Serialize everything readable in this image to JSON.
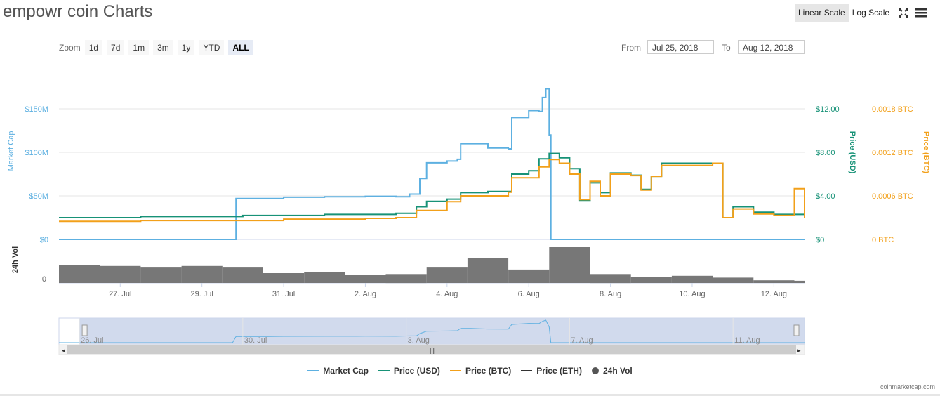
{
  "title": "empowr coin Charts",
  "scale_buttons": {
    "linear": "Linear Scale",
    "log": "Log Scale"
  },
  "icons": {
    "fullscreen": "fullscreen-icon",
    "menu": "hamburger-menu-icon"
  },
  "zoom": {
    "label": "Zoom",
    "buttons": [
      "1d",
      "7d",
      "1m",
      "3m",
      "1y",
      "YTD",
      "ALL"
    ],
    "active": "ALL"
  },
  "range": {
    "from_label": "From",
    "from_value": "Jul 25, 2018",
    "to_label": "To",
    "to_value": "Aug 12, 2018"
  },
  "colors": {
    "market_cap": "#5db0e1",
    "price_usd": "#179277",
    "price_btc": "#f2a01a",
    "price_eth": "#333333",
    "volume": "#777777",
    "navigator_fill": "#ccd6eb"
  },
  "chart_data": {
    "type": "line",
    "x_range": [
      "2018-07-25T12:00",
      "2018-08-12T18:00"
    ],
    "x_ticks": [
      {
        "date": "2018-07-27",
        "label": "27. Jul"
      },
      {
        "date": "2018-07-29",
        "label": "29. Jul"
      },
      {
        "date": "2018-07-31",
        "label": "31. Jul"
      },
      {
        "date": "2018-08-02",
        "label": "2. Aug"
      },
      {
        "date": "2018-08-04",
        "label": "4. Aug"
      },
      {
        "date": "2018-08-06",
        "label": "6. Aug"
      },
      {
        "date": "2018-08-08",
        "label": "8. Aug"
      },
      {
        "date": "2018-08-10",
        "label": "10. Aug"
      },
      {
        "date": "2018-08-12",
        "label": "12. Aug"
      }
    ],
    "axes": {
      "market_cap": {
        "title": "Market Cap",
        "range": [
          0,
          150000000
        ],
        "ticks": [
          {
            "value": 0,
            "label": "$0"
          },
          {
            "value": 50000000,
            "label": "$50M"
          },
          {
            "value": 100000000,
            "label": "$100M"
          },
          {
            "value": 150000000,
            "label": "$150M"
          }
        ]
      },
      "price_usd": {
        "title": "Price (USD)",
        "range": [
          0,
          12
        ],
        "ticks": [
          {
            "value": 0,
            "label": "$0"
          },
          {
            "value": 4,
            "label": "$4.00"
          },
          {
            "value": 8,
            "label": "$8.00"
          },
          {
            "value": 12,
            "label": "$12.00"
          }
        ]
      },
      "price_btc": {
        "title": "Price (BTC)",
        "range": [
          0,
          0.0018
        ],
        "ticks": [
          {
            "value": 0,
            "label": "0 BTC"
          },
          {
            "value": 0.0006,
            "label": "0.0006 BTC"
          },
          {
            "value": 0.0012,
            "label": "0.0012 BTC"
          },
          {
            "value": 0.0018,
            "label": "0.0018 BTC"
          }
        ]
      },
      "volume": {
        "title": "24h Vol",
        "ticks": [
          {
            "value": 0,
            "label": "0"
          }
        ]
      }
    },
    "series": [
      {
        "name": "Market Cap",
        "axis": "market_cap",
        "points": [
          [
            "2018-07-25T12:00",
            0
          ],
          [
            "2018-07-29T18:00",
            0
          ],
          [
            "2018-07-29T20:00",
            47000000
          ],
          [
            "2018-07-30T12:00",
            47000000
          ],
          [
            "2018-07-31T00:00",
            48500000
          ],
          [
            "2018-08-01T00:00",
            49000000
          ],
          [
            "2018-08-02T00:00",
            49500000
          ],
          [
            "2018-08-02T18:00",
            49000000
          ],
          [
            "2018-08-03T02:00",
            52000000
          ],
          [
            "2018-08-03T06:00",
            52000000
          ],
          [
            "2018-08-03T08:00",
            70000000
          ],
          [
            "2018-08-03T12:00",
            88000000
          ],
          [
            "2018-08-04T00:00",
            90000000
          ],
          [
            "2018-08-04T06:00",
            92000000
          ],
          [
            "2018-08-04T08:00",
            110000000
          ],
          [
            "2018-08-04T14:00",
            110000000
          ],
          [
            "2018-08-05T00:00",
            105000000
          ],
          [
            "2018-08-05T12:00",
            104000000
          ],
          [
            "2018-08-05T14:00",
            140000000
          ],
          [
            "2018-08-06T00:00",
            148000000
          ],
          [
            "2018-08-06T06:00",
            147000000
          ],
          [
            "2018-08-06T08:00",
            163000000
          ],
          [
            "2018-08-06T10:00",
            173000000
          ],
          [
            "2018-08-06T12:00",
            120000000
          ],
          [
            "2018-08-06T13:00",
            0
          ],
          [
            "2018-08-12T18:00",
            0
          ]
        ]
      },
      {
        "name": "Price (USD)",
        "axis": "price_usd",
        "points": [
          [
            "2018-07-25T12:00",
            2.0
          ],
          [
            "2018-07-26T12:00",
            2.0
          ],
          [
            "2018-07-27T12:00",
            2.1
          ],
          [
            "2018-07-29T00:00",
            2.1
          ],
          [
            "2018-07-30T00:00",
            2.2
          ],
          [
            "2018-07-31T00:00",
            2.2
          ],
          [
            "2018-08-01T00:00",
            2.3
          ],
          [
            "2018-08-02T00:00",
            2.3
          ],
          [
            "2018-08-02T18:00",
            2.4
          ],
          [
            "2018-08-03T06:00",
            3.0
          ],
          [
            "2018-08-03T12:00",
            3.5
          ],
          [
            "2018-08-04T00:00",
            3.7
          ],
          [
            "2018-08-04T08:00",
            4.3
          ],
          [
            "2018-08-05T00:00",
            4.4
          ],
          [
            "2018-08-05T12:00",
            4.4
          ],
          [
            "2018-08-05T14:00",
            6.0
          ],
          [
            "2018-08-06T00:00",
            6.3
          ],
          [
            "2018-08-06T06:00",
            7.4
          ],
          [
            "2018-08-06T12:00",
            7.9
          ],
          [
            "2018-08-06T18:00",
            7.5
          ],
          [
            "2018-08-07T00:00",
            6.5
          ],
          [
            "2018-08-07T06:00",
            3.6
          ],
          [
            "2018-08-07T12:00",
            5.2
          ],
          [
            "2018-08-07T18:00",
            4.3
          ],
          [
            "2018-08-08T00:00",
            6.1
          ],
          [
            "2018-08-08T12:00",
            5.9
          ],
          [
            "2018-08-08T18:00",
            4.6
          ],
          [
            "2018-08-09T00:00",
            5.8
          ],
          [
            "2018-08-09T06:00",
            7.0
          ],
          [
            "2018-08-09T18:00",
            7.0
          ],
          [
            "2018-08-10T00:00",
            7.0
          ],
          [
            "2018-08-10T12:00",
            7.0
          ],
          [
            "2018-08-10T18:00",
            2.0
          ],
          [
            "2018-08-11T00:00",
            3.0
          ],
          [
            "2018-08-11T12:00",
            2.5
          ],
          [
            "2018-08-12T00:00",
            2.3
          ],
          [
            "2018-08-12T18:00",
            2.0
          ]
        ]
      },
      {
        "name": "Price (BTC)",
        "axis": "price_btc",
        "points": [
          [
            "2018-07-25T12:00",
            0.00025
          ],
          [
            "2018-07-27T12:00",
            0.00026
          ],
          [
            "2018-07-29T00:00",
            0.00026
          ],
          [
            "2018-07-31T00:00",
            0.00028
          ],
          [
            "2018-08-02T00:00",
            0.00029
          ],
          [
            "2018-08-02T18:00",
            0.0003
          ],
          [
            "2018-08-03T06:00",
            0.0004
          ],
          [
            "2018-08-04T00:00",
            0.00052
          ],
          [
            "2018-08-04T08:00",
            0.0006
          ],
          [
            "2018-08-05T12:00",
            0.00065
          ],
          [
            "2018-08-05T14:00",
            0.00085
          ],
          [
            "2018-08-06T06:00",
            0.001
          ],
          [
            "2018-08-06T12:00",
            0.0011
          ],
          [
            "2018-08-06T18:00",
            0.00105
          ],
          [
            "2018-08-07T00:00",
            0.0009
          ],
          [
            "2018-08-07T06:00",
            0.00055
          ],
          [
            "2018-08-07T12:00",
            0.0008
          ],
          [
            "2018-08-07T18:00",
            0.0006
          ],
          [
            "2018-08-08T00:00",
            0.0009
          ],
          [
            "2018-08-08T12:00",
            0.00088
          ],
          [
            "2018-08-08T18:00",
            0.00068
          ],
          [
            "2018-08-09T00:00",
            0.00087
          ],
          [
            "2018-08-09T06:00",
            0.00102
          ],
          [
            "2018-08-10T12:00",
            0.00105
          ],
          [
            "2018-08-10T18:00",
            0.0003
          ],
          [
            "2018-08-11T00:00",
            0.00042
          ],
          [
            "2018-08-11T12:00",
            0.00035
          ],
          [
            "2018-08-12T00:00",
            0.00033
          ],
          [
            "2018-08-12T12:00",
            0.0007
          ],
          [
            "2018-08-12T18:00",
            0.0003
          ]
        ]
      }
    ],
    "volume_bars": [
      [
        "2018-07-25T12:00",
        1.0
      ],
      [
        "2018-07-26T12:00",
        0.95
      ],
      [
        "2018-07-27T12:00",
        0.9
      ],
      [
        "2018-07-28T12:00",
        0.95
      ],
      [
        "2018-07-29T12:00",
        0.9
      ],
      [
        "2018-07-30T12:00",
        0.55
      ],
      [
        "2018-07-31T12:00",
        0.6
      ],
      [
        "2018-08-01T12:00",
        0.45
      ],
      [
        "2018-08-02T12:00",
        0.5
      ],
      [
        "2018-08-03T12:00",
        0.9
      ],
      [
        "2018-08-04T12:00",
        1.4
      ],
      [
        "2018-08-05T12:00",
        0.75
      ],
      [
        "2018-08-06T12:00",
        2.0
      ],
      [
        "2018-08-07T12:00",
        0.5
      ],
      [
        "2018-08-08T12:00",
        0.35
      ],
      [
        "2018-08-09T12:00",
        0.4
      ],
      [
        "2018-08-10T12:00",
        0.3
      ],
      [
        "2018-08-11T12:00",
        0.15
      ],
      [
        "2018-08-12T12:00",
        0.12
      ]
    ],
    "navigator": {
      "selected": [
        "2018-07-26T00:00",
        "2018-08-12T18:00"
      ],
      "labels": [
        {
          "date": "2018-07-26",
          "label": "26. Jul"
        },
        {
          "date": "2018-07-30",
          "label": "30. Jul"
        },
        {
          "date": "2018-08-03",
          "label": "3. Aug"
        },
        {
          "date": "2018-08-07",
          "label": "7. Aug"
        },
        {
          "date": "2018-08-11",
          "label": "11. Aug"
        }
      ]
    },
    "legend": [
      {
        "name": "Market Cap",
        "kind": "line",
        "color": "#5db0e1"
      },
      {
        "name": "Price (USD)",
        "kind": "line",
        "color": "#179277"
      },
      {
        "name": "Price (BTC)",
        "kind": "line",
        "color": "#f2a01a"
      },
      {
        "name": "Price (ETH)",
        "kind": "line",
        "color": "#333333"
      },
      {
        "name": "24h Vol",
        "kind": "dot",
        "color": "#555555"
      }
    ]
  },
  "credit": "coinmarketcap.com"
}
